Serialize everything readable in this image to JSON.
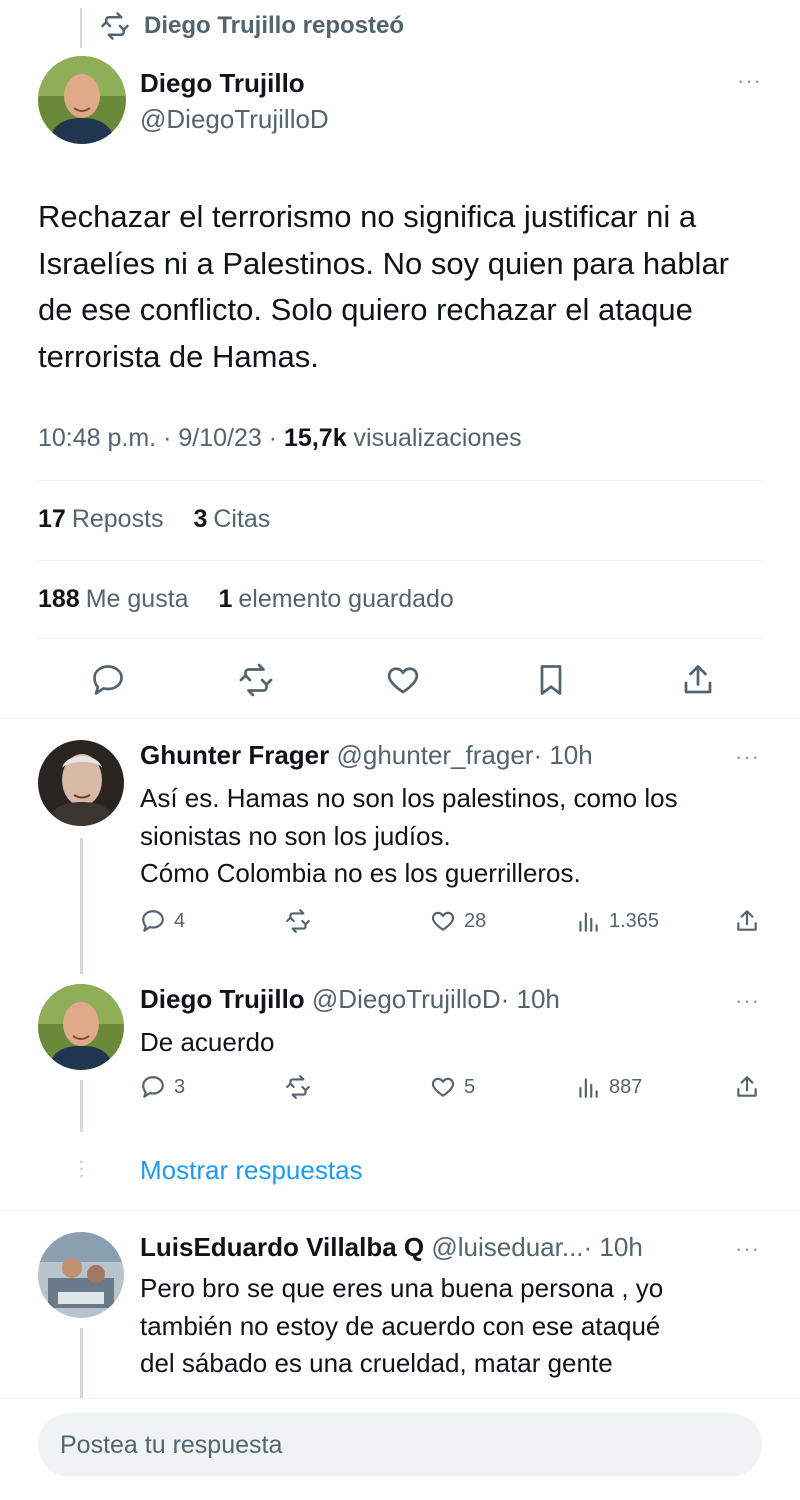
{
  "repost_banner": {
    "text": "Diego Trujillo reposteó",
    "icon": "repost-icon"
  },
  "main_post": {
    "author_name": "Diego Trujillo",
    "author_handle": "@DiegoTrujilloD",
    "more": "···",
    "text": "Rechazar el terrorismo no significa justificar ni a Israelíes ni a Palestinos. No soy quien para hablar de ese conflicto. Solo quiero rechazar el ataque terrorista de Hamas.",
    "time": "10:48 p.m.",
    "date": "9/10/23",
    "sep": "·",
    "views_count": "15,7k",
    "views_label": "visualizaciones",
    "reposts_count": "17",
    "reposts_label": "Reposts",
    "quotes_count": "3",
    "quotes_label": "Citas",
    "likes_count": "188",
    "likes_label": "Me gusta",
    "bookmarks_count": "1",
    "bookmarks_label": "elemento guardado",
    "actions": [
      "reply-icon",
      "repost-icon",
      "like-icon",
      "bookmark-icon",
      "share-icon"
    ]
  },
  "replies": [
    {
      "name": "Ghunter Frager",
      "handle": "@ghunter_frager",
      "time": "· 10h",
      "more": "···",
      "text_lines": [
        "Así es. Hamas no son los palestinos, como los",
        "sionistas no son los judíos.",
        "Cómo Colombia no es los guerrilleros."
      ],
      "reply_count": "4",
      "repost_count": "",
      "like_count": "28",
      "view_count": "1.365"
    },
    {
      "name": "Diego Trujillo",
      "handle": "@DiegoTrujilloD",
      "time": "· 10h",
      "more": "···",
      "text_lines": [
        "De acuerdo"
      ],
      "reply_count": "3",
      "repost_count": "",
      "like_count": "5",
      "view_count": "887"
    },
    {
      "name": "LuisEduardo Villalba Q",
      "handle": "@luiseduar...",
      "time": "· 10h",
      "more": "···",
      "text_lines": [
        "Pero bro se que eres una buena persona , yo",
        "también no estoy de acuerdo con ese ataqué",
        "del sábado es una crueldad, matar gente"
      ]
    }
  ],
  "show_replies_label": "Mostrar respuestas",
  "compose": {
    "placeholder": "Postea tu respuesta"
  },
  "colors": {
    "accent": "#1d9bf0",
    "secondary_text": "#536471",
    "divider": "#eff3f4"
  }
}
